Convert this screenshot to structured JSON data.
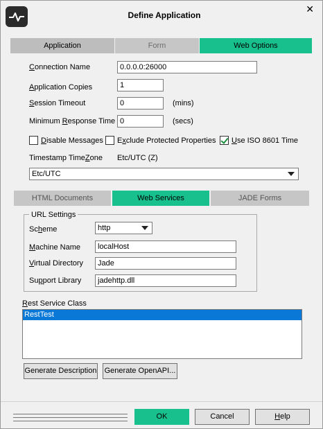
{
  "window": {
    "title": "Define Application",
    "close_glyph": "✕"
  },
  "main_tabs": [
    {
      "label": "Application"
    },
    {
      "label": "Form"
    },
    {
      "label": "Web Options"
    }
  ],
  "web_options": {
    "connection_name": {
      "label_pre": "",
      "label_u": "C",
      "label_post": "onnection Name",
      "value": "0.0.0.0:26000"
    },
    "application_copies": {
      "label_pre": "",
      "label_u": "A",
      "label_post": "pplication Copies",
      "value": "1"
    },
    "session_timeout": {
      "label_pre": "",
      "label_u": "S",
      "label_post": "ession Timeout",
      "value": "0",
      "unit": "(mins)"
    },
    "min_response_time": {
      "label_pre": "Minimum ",
      "label_u": "R",
      "label_post": "esponse Time",
      "value": "0",
      "unit": "(secs)"
    },
    "disable_messages": {
      "label_pre": "",
      "label_u": "D",
      "label_post": "isable Messages",
      "checked": false
    },
    "exclude_protected": {
      "label_pre": "E",
      "label_u": "x",
      "label_post": "clude Protected Properties",
      "checked": false
    },
    "use_iso": {
      "label_pre": "",
      "label_u": "U",
      "label_post": "se ISO 8601 Time",
      "checked": true
    },
    "timestamp_timezone": {
      "label_pre": "Timestamp Time",
      "label_u": "Z",
      "label_post": "one",
      "value": "Etc/UTC (Z)",
      "selected": "Etc/UTC"
    }
  },
  "sub_tabs": [
    {
      "label": "HTML Documents"
    },
    {
      "label": "Web Services"
    },
    {
      "label": "JADE Forms"
    }
  ],
  "url_settings": {
    "legend": "URL Settings",
    "scheme": {
      "label_pre": "Sc",
      "label_u": "h",
      "label_post": "eme",
      "value": "http"
    },
    "machine_name": {
      "label_pre": "",
      "label_u": "M",
      "label_post": "achine Name",
      "value": "localHost"
    },
    "virtual_directory": {
      "label_pre": "",
      "label_u": "V",
      "label_post": "irtual Directory",
      "value": "Jade"
    },
    "support_library": {
      "label_pre": "Su",
      "label_u": "p",
      "label_post": "port Library",
      "value": "jadehttp.dll"
    }
  },
  "rest_service": {
    "label_pre": "",
    "label_u": "R",
    "label_post": "est Service Class",
    "items": [
      "RestTest"
    ]
  },
  "actions": {
    "generate_description": "Generate Description",
    "generate_openapi": "Generate OpenAPI..."
  },
  "footer": {
    "ok": "OK",
    "cancel": "Cancel",
    "help_u": "H",
    "help_post": "elp"
  },
  "colors": {
    "accent": "#17c08d",
    "selection": "#0a78d7"
  }
}
